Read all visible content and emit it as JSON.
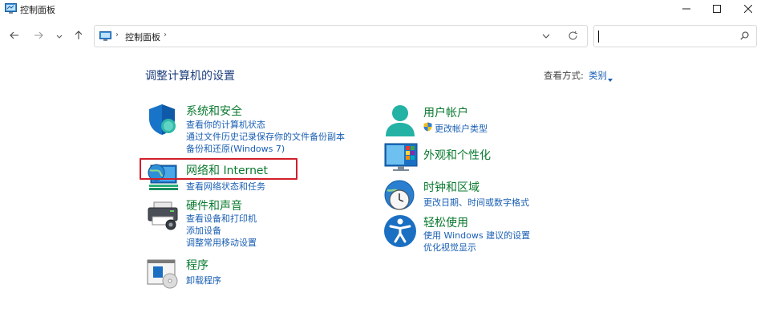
{
  "window": {
    "title": "控制面板"
  },
  "address": {
    "breadcrumb": "控制面板",
    "separator": "›"
  },
  "search": {
    "placeholder": ""
  },
  "page": {
    "title": "调整计算机的设置",
    "view_by_label": "查看方式:",
    "view_by_value": "类别"
  },
  "categories": {
    "security": {
      "title": "系统和安全",
      "links": [
        "查看你的计算机状态",
        "通过文件历史记录保存你的文件备份副本",
        "备份和还原(Windows 7)"
      ]
    },
    "network": {
      "title": "网络和 Internet",
      "links": [
        "查看网络状态和任务"
      ]
    },
    "hardware": {
      "title": "硬件和声音",
      "links": [
        "查看设备和打印机",
        "添加设备",
        "调整常用移动设置"
      ]
    },
    "programs": {
      "title": "程序",
      "links": [
        "卸载程序"
      ]
    },
    "accounts": {
      "title": "用户帐户",
      "links": [
        "更改帐户类型"
      ]
    },
    "appearance": {
      "title": "外观和个性化",
      "links": []
    },
    "clock": {
      "title": "时钟和区域",
      "links": [
        "更改日期、时间或数字格式"
      ]
    },
    "ease": {
      "title": "轻松使用",
      "links": [
        "使用 Windows 建议的设置",
        "优化视觉显示"
      ]
    }
  },
  "colors": {
    "category_title": "#0a7a2f",
    "link": "#1a5fb4",
    "heading": "#1c3e7c",
    "highlight_box": "#d21f2a"
  }
}
